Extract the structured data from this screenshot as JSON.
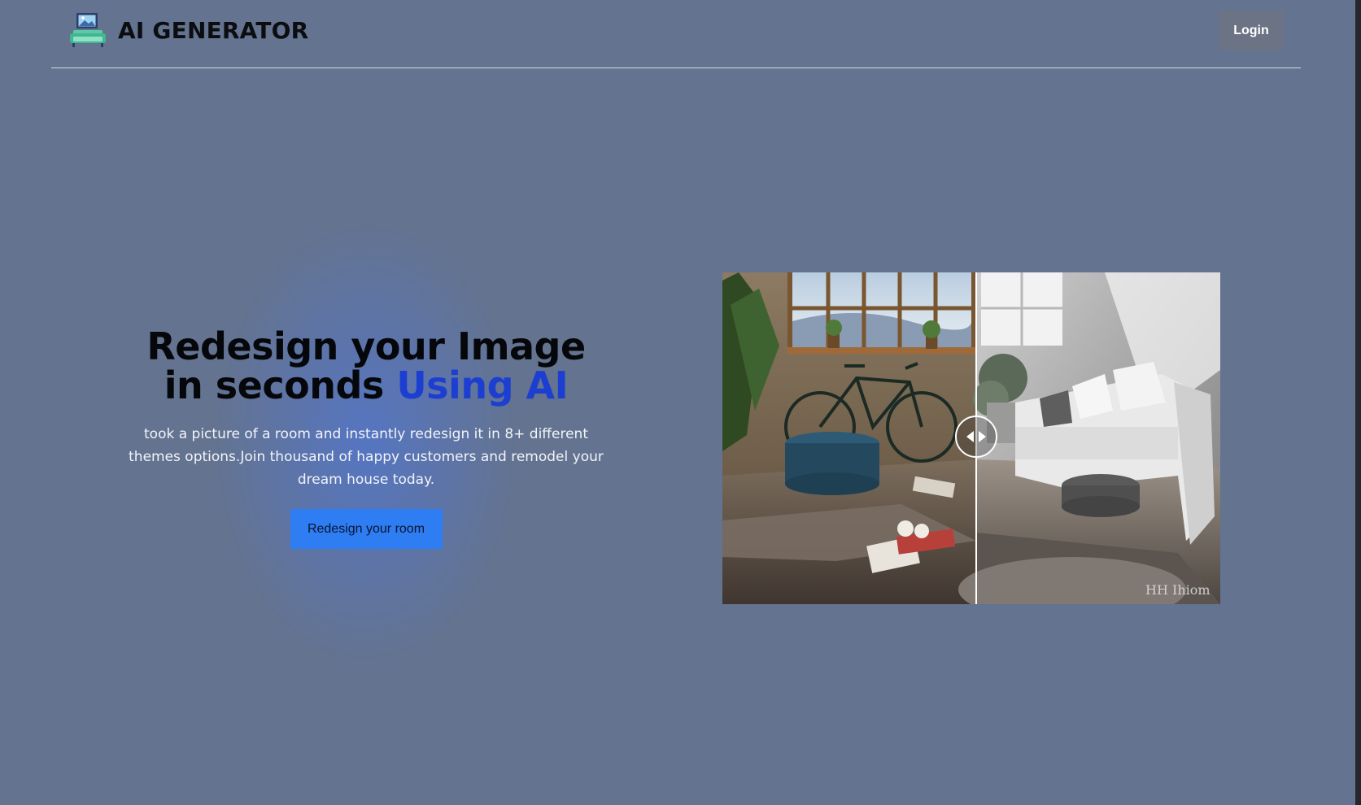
{
  "header": {
    "brand": "AI GENERATOR",
    "logo_icon": "room-sofa-icon",
    "login_label": "Login"
  },
  "hero": {
    "headline_main": "Redesign your Image in seconds",
    "headline_accent": "Using AI",
    "subtext": "took a picture of a room and instantly redesign it in 8+ different themes options.Join thousand of happy customers and remodel your dream house today.",
    "cta_label": "Redesign your room"
  },
  "comparison": {
    "before_label": "",
    "after_label": "",
    "watermark": "HH Ihiom",
    "handle_icon": "arrows-left-right-icon"
  },
  "colors": {
    "background": "#637390",
    "accent": "#1d3fd1",
    "cta_bg": "#2e7df2",
    "login_bg": "#6b7385"
  }
}
